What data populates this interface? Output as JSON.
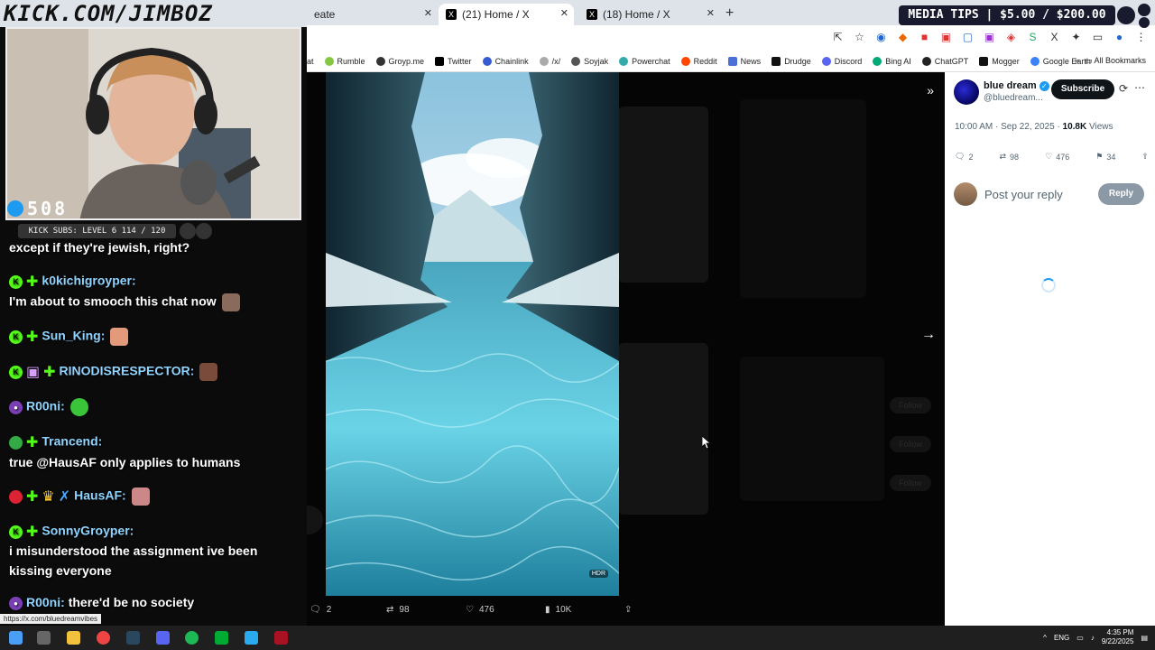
{
  "stream": {
    "logo": "KICK.COM/JIMBOZ",
    "viewers": "508",
    "subs_bar": "KICK SUBS: LEVEL 6 114 / 120",
    "media_tips": "MEDIA TIPS | $5.00 / $200.00"
  },
  "chat": [
    {
      "user": "",
      "text": "except if they're jewish, right?"
    },
    {
      "user": "k0kichigroyper:",
      "text": ""
    },
    {
      "user": "",
      "text": "I'm about to smooch this chat now"
    },
    {
      "user": "Sun_King:",
      "text": ""
    },
    {
      "user": "RINODISRESPECTOR:",
      "text": ""
    },
    {
      "user": "R00ni:",
      "text": ""
    },
    {
      "user": "Trancend:",
      "text": ""
    },
    {
      "user": "",
      "text": "true @HausAF only applies to humans"
    },
    {
      "user": "HausAF:",
      "text": ""
    },
    {
      "user": "SonnyGroyper:",
      "text": ""
    },
    {
      "user": "",
      "text": "i misunderstood the assignment ive been"
    },
    {
      "user": "",
      "text": "kissing everyone"
    },
    {
      "user": "R00ni:",
      "text": "there'd be no society"
    }
  ],
  "browser": {
    "tabs": [
      {
        "label": "eate"
      },
      {
        "label": "(21) Home / X"
      },
      {
        "label": "(18) Home / X"
      }
    ],
    "bookmarks": [
      "at",
      "Rumble",
      "Groyp.me",
      "Twitter",
      "Chainlink",
      "/x/",
      "Soyjak",
      "Powerchat",
      "Reddit",
      "News",
      "Drudge",
      "Discord",
      "Bing AI",
      "ChatGPT",
      "Mogger",
      "Google Earth"
    ],
    "all_bookmarks": "All Bookmarks",
    "status_url": "https://x.com/bluedreamvibes"
  },
  "post": {
    "author_name": "blue dream",
    "author_handle": "@bluedream...",
    "subscribe_label": "Subscribe",
    "time": "10:00 AM · Sep 22, 2025 · ",
    "views_count": "10.8K",
    "views_label": " Views",
    "replies": "2",
    "reposts": "98",
    "likes": "476",
    "bookmarks": "34",
    "reply_placeholder": "Post your reply",
    "reply_button": "Reply",
    "bottom": {
      "replies": "2",
      "reposts": "98",
      "likes": "476",
      "views": "10K"
    }
  },
  "taskbar": {
    "lang": "ENG",
    "time": "4:35 PM",
    "date": "9/22/2025"
  },
  "colors": {
    "x_blue": "#1d9bf0",
    "kick_green": "#53fc18",
    "chat_user": "#8fd4ff"
  }
}
